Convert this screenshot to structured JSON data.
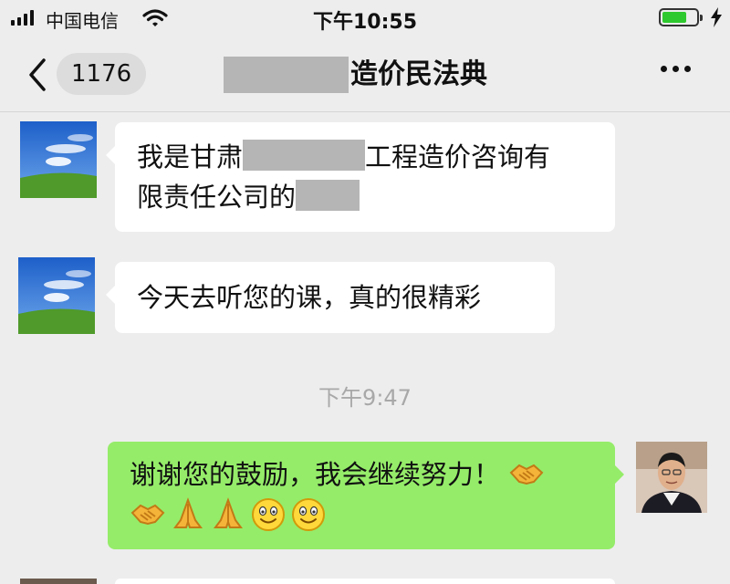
{
  "status_bar": {
    "carrier": "中国电信",
    "time": "下午10:55",
    "battery_level": 0.65,
    "charging_icon": "bolt-icon"
  },
  "nav": {
    "back_count": "1176",
    "title": "造价民法典"
  },
  "messages": [
    {
      "sender": "other",
      "line1_pre": "我是甘肃",
      "line1_post": "工程造价咨询有",
      "line2_pre": "限责任公司的"
    },
    {
      "sender": "other",
      "text": "今天去听您的课，真的很精彩"
    },
    {
      "timestamp": "下午9:47"
    },
    {
      "sender": "self",
      "text": "谢谢您的鼓励，我会继续努力！",
      "emojis": [
        "handshake-emoji",
        "handshake-emoji",
        "pray-emoji",
        "pray-emoji",
        "smile-emoji",
        "smile-emoji"
      ]
    }
  ],
  "colors": {
    "background": "#ededed",
    "self_bubble": "#95ec69",
    "other_bubble": "#ffffff"
  }
}
